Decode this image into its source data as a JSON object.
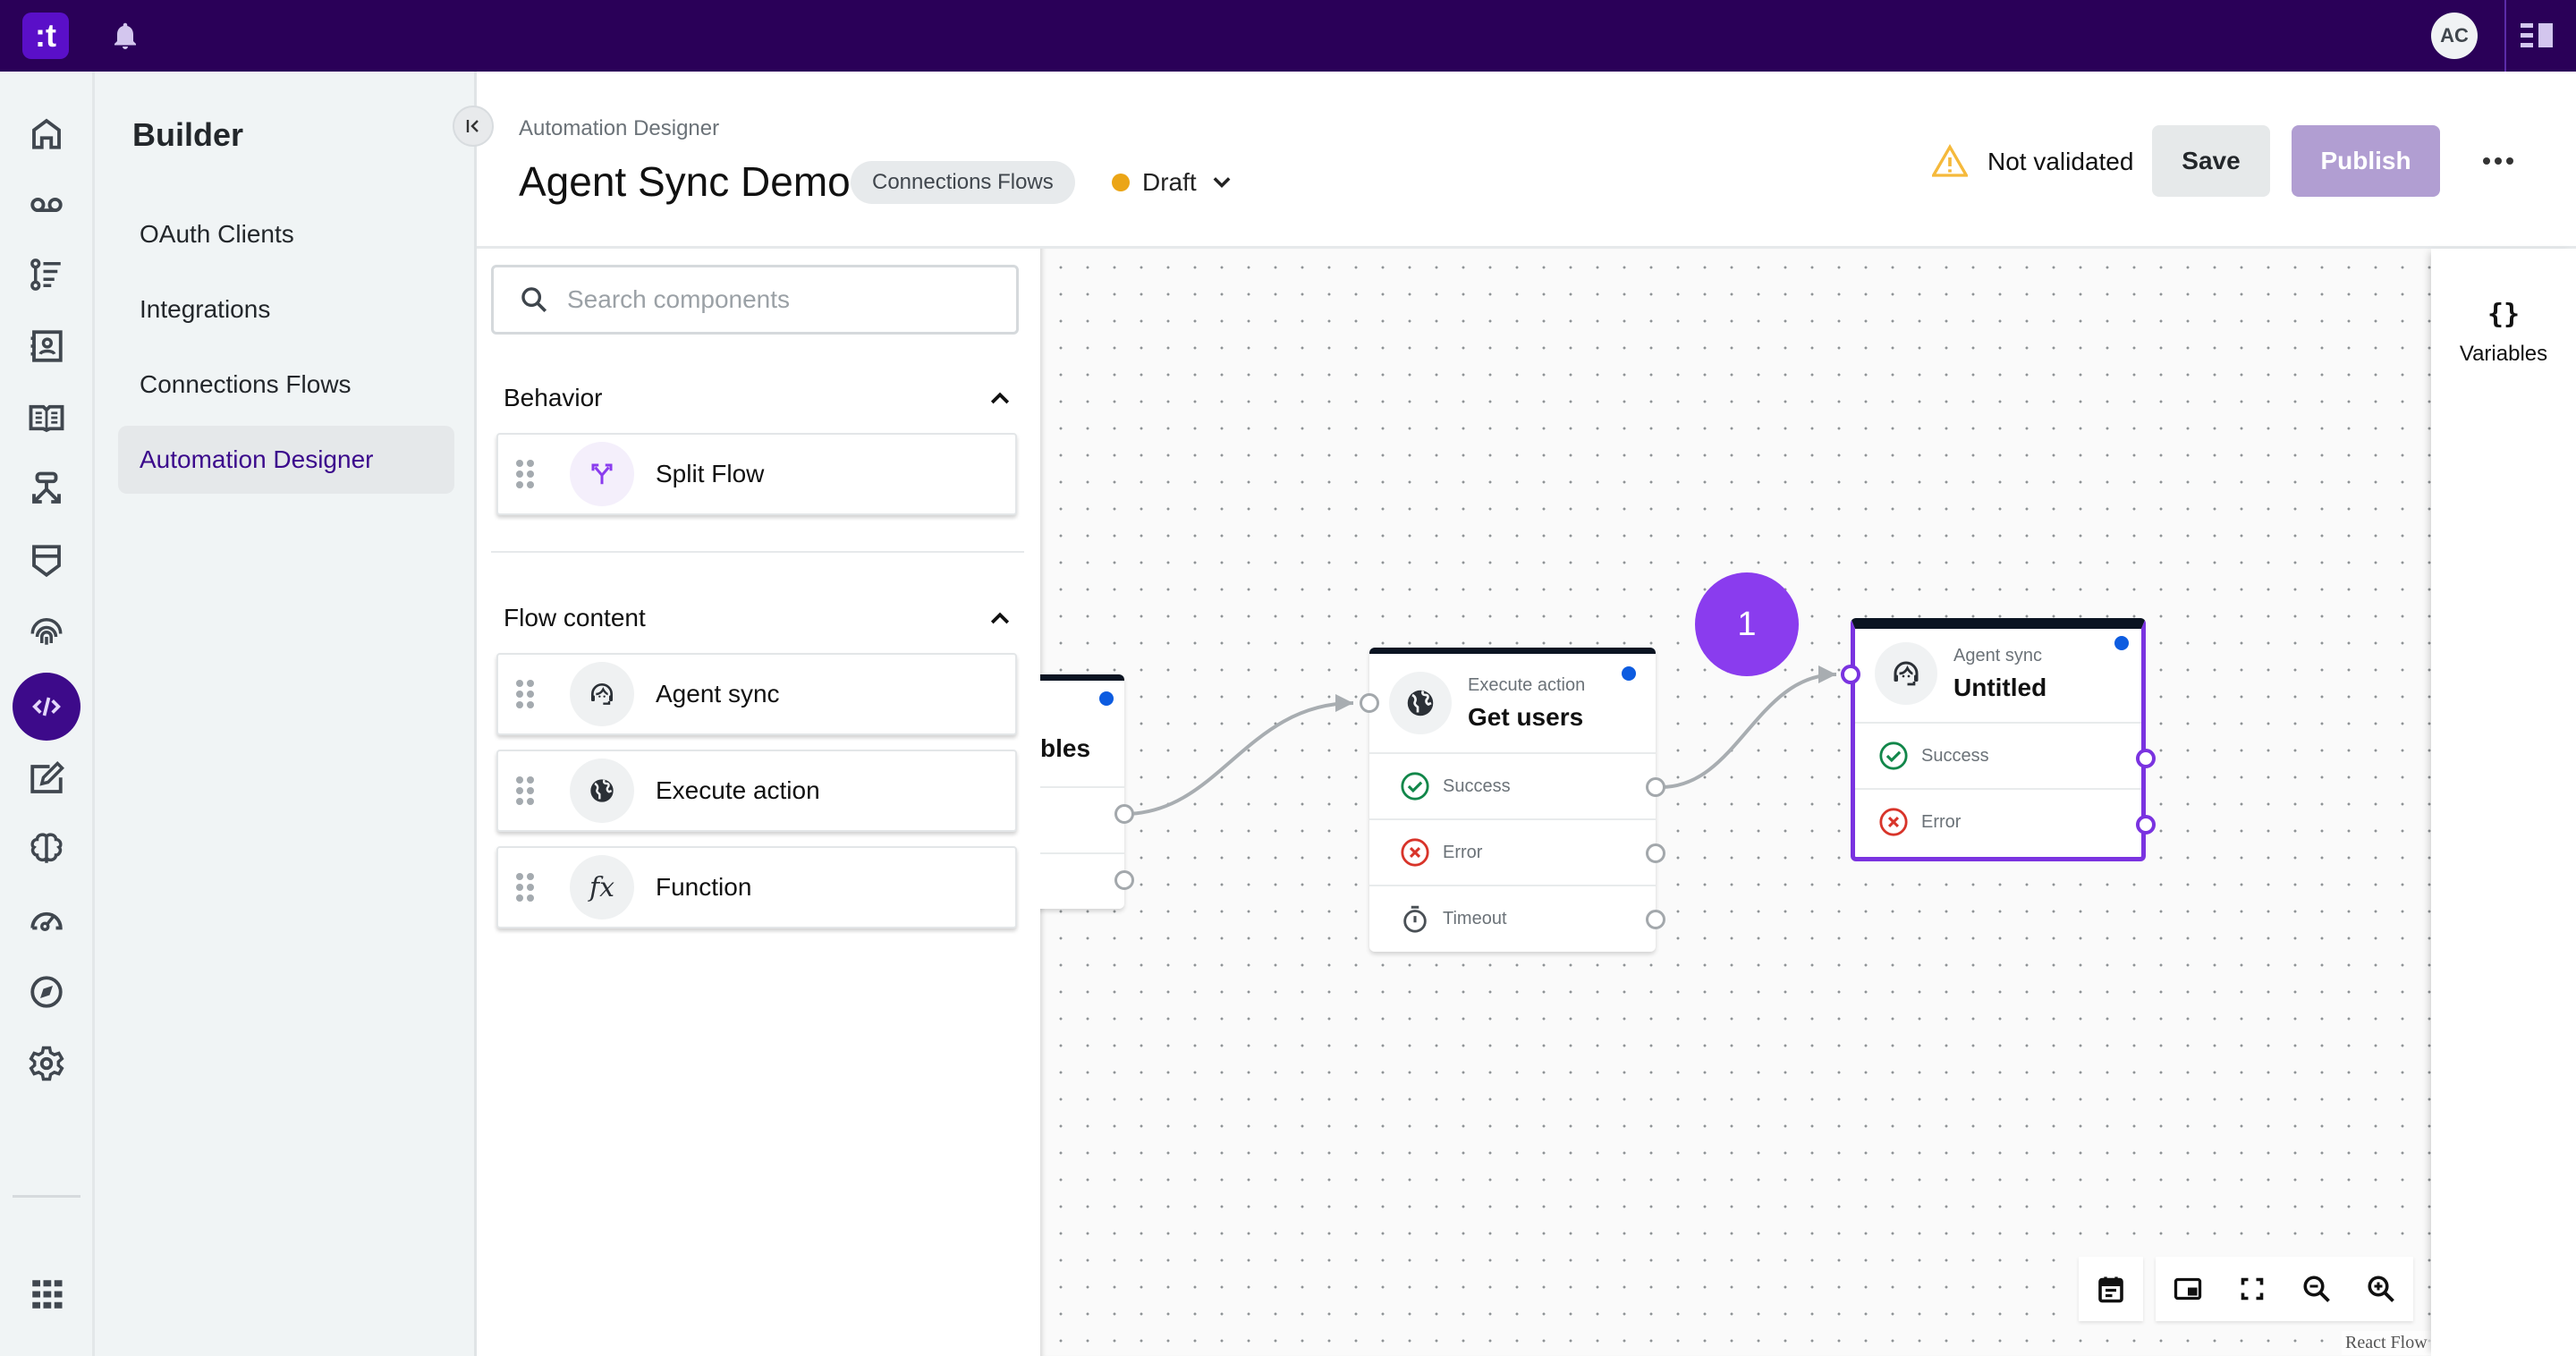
{
  "topbar": {
    "logo_text": ":t",
    "avatar_initials": "AC"
  },
  "rail": {
    "items": [
      {
        "icon": "home-icon"
      },
      {
        "icon": "voicemail-icon"
      },
      {
        "icon": "journey-list-icon"
      },
      {
        "icon": "contacts-book-icon"
      },
      {
        "icon": "knowledge-book-icon"
      },
      {
        "icon": "routing-icon"
      },
      {
        "icon": "shield-icon"
      },
      {
        "icon": "fingerprint-icon"
      },
      {
        "icon": "code-icon",
        "active": true
      },
      {
        "icon": "edit-note-icon"
      },
      {
        "icon": "brain-icon"
      },
      {
        "icon": "speedometer-icon"
      },
      {
        "icon": "compass-icon"
      },
      {
        "icon": "settings-icon"
      },
      {
        "icon": "apps-grid-icon"
      }
    ]
  },
  "builder": {
    "title": "Builder",
    "items": [
      {
        "label": "OAuth Clients"
      },
      {
        "label": "Integrations"
      },
      {
        "label": "Connections Flows"
      },
      {
        "label": "Automation Designer",
        "active": true
      }
    ]
  },
  "header": {
    "breadcrumb": "Automation Designer",
    "title": "Agent Sync Demo",
    "category_chip": "Connections Flows",
    "status": "Draft",
    "status_color": "#eba516",
    "validation": "Not validated",
    "save_label": "Save",
    "publish_label": "Publish"
  },
  "components": {
    "search_placeholder": "Search components",
    "sections": [
      {
        "title": "Behavior",
        "items": [
          {
            "label": "Split Flow",
            "icon": "split-flow-icon"
          }
        ]
      },
      {
        "title": "Flow content",
        "items": [
          {
            "label": "Agent sync",
            "icon": "agent-headset-icon"
          },
          {
            "label": "Execute action",
            "icon": "globe-icon"
          },
          {
            "label": "Function",
            "icon": "function-icon"
          }
        ]
      }
    ]
  },
  "canvas": {
    "nodes": [
      {
        "type": "",
        "name": "bles",
        "partial": true
      },
      {
        "type": "Execute action",
        "name": "Get users",
        "outputs": [
          {
            "label": "Success"
          },
          {
            "label": "Error"
          },
          {
            "label": "Timeout"
          }
        ]
      },
      {
        "type": "Agent sync",
        "name": "Untitled",
        "selected": true,
        "outputs": [
          {
            "label": "Success"
          },
          {
            "label": "Error"
          }
        ]
      }
    ],
    "step_badge": "1",
    "accent_color": "#7a33e0",
    "attribution": "React Flow"
  },
  "variables_panel": {
    "icon_text": "{}",
    "label": "Variables"
  }
}
